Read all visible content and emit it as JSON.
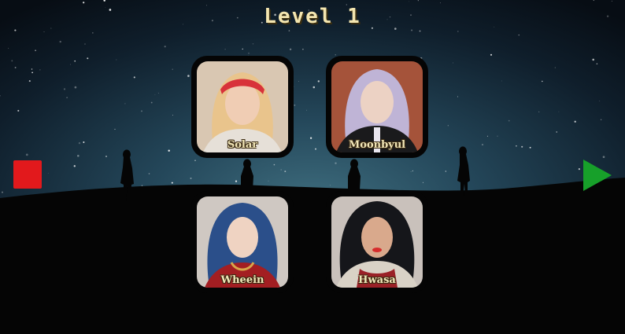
{
  "header": {
    "title": "Level 1"
  },
  "cards": [
    {
      "name": "Solar",
      "bg": "#d9c7b2",
      "hair": "#e9c48c",
      "accent": "#d8323a",
      "outfit": "#e6e0d8"
    },
    {
      "name": "Moonbyul",
      "bg": "#a5533a",
      "hair": "#bfb4d6",
      "accent": "#e9e6ee",
      "outfit": "#1a1a1c"
    },
    {
      "name": "Wheein",
      "bg": "#cfc8c2",
      "hair": "#2b4f8a",
      "accent": "#d8a74a",
      "outfit": "#a31e22"
    },
    {
      "name": "Hwasa",
      "bg": "#c9c1bb",
      "hair": "#15161a",
      "accent": "#d72c2c",
      "outfit": "#d9d2c6"
    }
  ],
  "controls": {
    "stop_icon": "stop-square-icon",
    "play_icon": "play-triangle-icon",
    "stop_color": "#e2191c",
    "play_color": "#17a02a"
  },
  "colors": {
    "sky_top": "#0b1520",
    "sky_mid": "#24475a",
    "ground": "#050505",
    "title": "#f4e6b0"
  }
}
